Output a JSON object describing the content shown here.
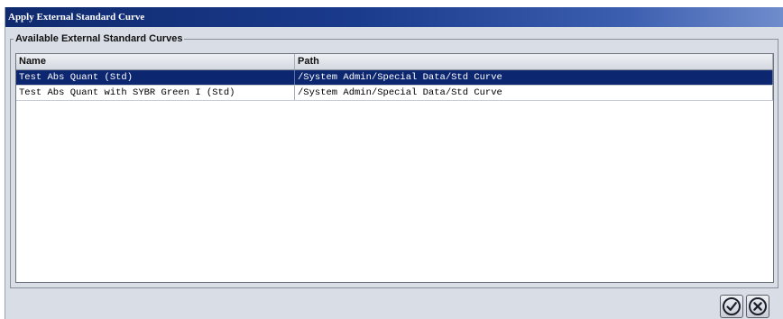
{
  "window": {
    "title": "Apply External Standard Curve"
  },
  "group": {
    "legend": "Available External Standard Curves"
  },
  "table": {
    "columns": [
      "Name",
      "Path"
    ],
    "rows": [
      {
        "name": "Test Abs Quant (Std)",
        "path": "/System Admin/Special Data/Std Curve",
        "selected": true
      },
      {
        "name": "Test Abs Quant with SYBR Green I (Std)",
        "path": "/System Admin/Special Data/Std Curve",
        "selected": false
      }
    ]
  },
  "buttons": {
    "ok_icon": "check-circle-icon",
    "cancel_icon": "x-circle-icon"
  },
  "colors": {
    "titlebar": "#0f2a6e",
    "selection": "#0c2670",
    "dialog_bg": "#d9dde6"
  }
}
